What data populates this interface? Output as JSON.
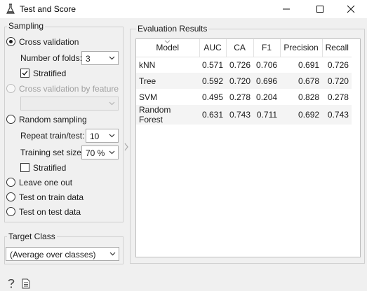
{
  "window": {
    "title": "Test and Score"
  },
  "sampling": {
    "title": "Sampling",
    "cross_validation": {
      "label": "Cross validation",
      "folds_label": "Number of folds:",
      "folds_value": "3",
      "stratified_label": "Stratified",
      "stratified_checked": true
    },
    "cross_validation_by_feature": {
      "label": "Cross validation by feature",
      "value": ""
    },
    "random_sampling": {
      "label": "Random sampling",
      "repeat_label": "Repeat train/test:",
      "repeat_value": "10",
      "train_size_label": "Training set size:",
      "train_size_value": "70 %",
      "stratified_label": "Stratified",
      "stratified_checked": false
    },
    "leave_one_out": "Leave one out",
    "test_on_train": "Test on train data",
    "test_on_test": "Test on test data",
    "selected": "Cross validation"
  },
  "target_class": {
    "title": "Target Class",
    "value": "(Average over classes)"
  },
  "results": {
    "title": "Evaluation Results",
    "columns": [
      "Model",
      "AUC",
      "CA",
      "F1",
      "Precision",
      "Recall"
    ],
    "rows": [
      [
        "kNN",
        "0.571",
        "0.726",
        "0.706",
        "0.691",
        "0.726"
      ],
      [
        "Tree",
        "0.592",
        "0.720",
        "0.696",
        "0.678",
        "0.720"
      ],
      [
        "SVM",
        "0.495",
        "0.278",
        "0.204",
        "0.828",
        "0.278"
      ],
      [
        "Random Forest",
        "0.631",
        "0.743",
        "0.711",
        "0.692",
        "0.743"
      ]
    ]
  },
  "icons": {
    "app": "flask-icon",
    "minimize": "minimize-icon",
    "maximize": "maximize-icon",
    "close": "close-icon",
    "help": "help-icon",
    "report": "report-icon"
  }
}
